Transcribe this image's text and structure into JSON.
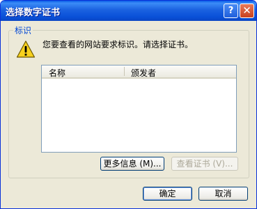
{
  "window": {
    "title": "选择数字证书"
  },
  "titlebar": {
    "help_label": "?",
    "close_label": "✕"
  },
  "group": {
    "legend": "标识"
  },
  "message": "您要查看的网站要求标识。请选择证书。",
  "list": {
    "columns": [
      "名称",
      "颁发者"
    ],
    "rows": []
  },
  "buttons": {
    "more_info": "更多信息 (M)...",
    "view_cert": "查看证书 (V)...",
    "ok": "确定",
    "cancel": "取消"
  },
  "icons": {
    "warning": "warning-icon"
  },
  "colors": {
    "title_bar": "#0a5ce6",
    "legend_text": "#0046d5",
    "dialog_bg": "#ece9d8"
  }
}
